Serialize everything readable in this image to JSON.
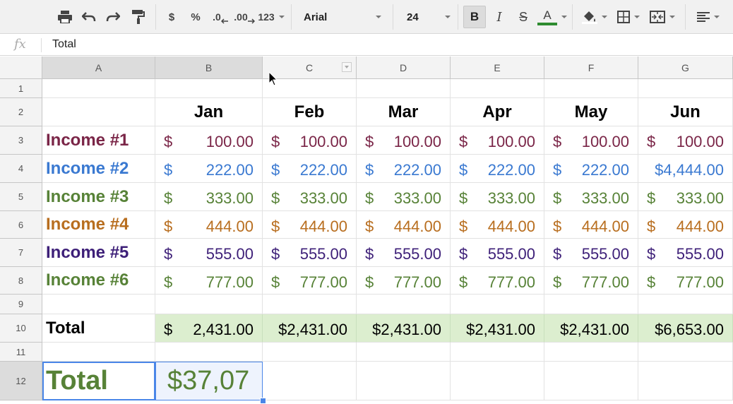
{
  "toolbar": {
    "currency": "$",
    "percent": "%",
    "decrease_decimal": ".0",
    "increase_decimal": ".00",
    "number_format": "123",
    "font": "Arial",
    "font_size": "24",
    "bold": "B",
    "italic": "I",
    "strikethrough": "S",
    "text_color_letter": "A",
    "text_color": "#2e8b30"
  },
  "formula_bar": {
    "icon": "fx",
    "value": "Total"
  },
  "columns": [
    "A",
    "B",
    "C",
    "D",
    "E",
    "F",
    "G"
  ],
  "rows": [
    "1",
    "2",
    "3",
    "4",
    "5",
    "6",
    "7",
    "8",
    "9",
    "10",
    "11",
    "12"
  ],
  "months": [
    "Jan",
    "Feb",
    "Mar",
    "Apr",
    "May",
    "Jun"
  ],
  "incomes": [
    {
      "label": "Income #1",
      "color": "#7a2547",
      "values": [
        [
          "$",
          "100.00"
        ],
        [
          "$",
          "100.00"
        ],
        [
          "$",
          "100.00"
        ],
        [
          "$",
          "100.00"
        ],
        [
          "$",
          "100.00"
        ],
        [
          "$",
          "100.00"
        ]
      ]
    },
    {
      "label": "Income #2",
      "color": "#3a79d1",
      "values": [
        [
          "$",
          "222.00"
        ],
        [
          "$",
          "222.00"
        ],
        [
          "$",
          "222.00"
        ],
        [
          "$",
          "222.00"
        ],
        [
          "$",
          "222.00"
        ],
        [
          "",
          "$4,444.00"
        ]
      ]
    },
    {
      "label": "Income #3",
      "color": "#578237",
      "values": [
        [
          "$",
          "333.00"
        ],
        [
          "$",
          "333.00"
        ],
        [
          "$",
          "333.00"
        ],
        [
          "$",
          "333.00"
        ],
        [
          "$",
          "333.00"
        ],
        [
          "$",
          "333.00"
        ]
      ]
    },
    {
      "label": "Income #4",
      "color": "#b86e1f",
      "values": [
        [
          "$",
          "444.00"
        ],
        [
          "$",
          "444.00"
        ],
        [
          "$",
          "444.00"
        ],
        [
          "$",
          "444.00"
        ],
        [
          "$",
          "444.00"
        ],
        [
          "$",
          "444.00"
        ]
      ]
    },
    {
      "label": "Income #5",
      "color": "#3d1f78",
      "values": [
        [
          "$",
          "555.00"
        ],
        [
          "$",
          "555.00"
        ],
        [
          "$",
          "555.00"
        ],
        [
          "$",
          "555.00"
        ],
        [
          "$",
          "555.00"
        ],
        [
          "$",
          "555.00"
        ]
      ]
    },
    {
      "label": "Income #6",
      "color": "#578237",
      "values": [
        [
          "$",
          "777.00"
        ],
        [
          "$",
          "777.00"
        ],
        [
          "$",
          "777.00"
        ],
        [
          "$",
          "777.00"
        ],
        [
          "$",
          "777.00"
        ],
        [
          "$",
          "777.00"
        ]
      ]
    }
  ],
  "total_row": {
    "label": "Total",
    "values": [
      [
        "$",
        "2,431.00"
      ],
      [
        "",
        "$2,431.00"
      ],
      [
        "",
        "$2,431.00"
      ],
      [
        "",
        "$2,431.00"
      ],
      [
        "",
        "$2,431.00"
      ],
      [
        "",
        "$6,653.00"
      ]
    ]
  },
  "grand_total": {
    "label": "Total",
    "value": "$37,07"
  }
}
